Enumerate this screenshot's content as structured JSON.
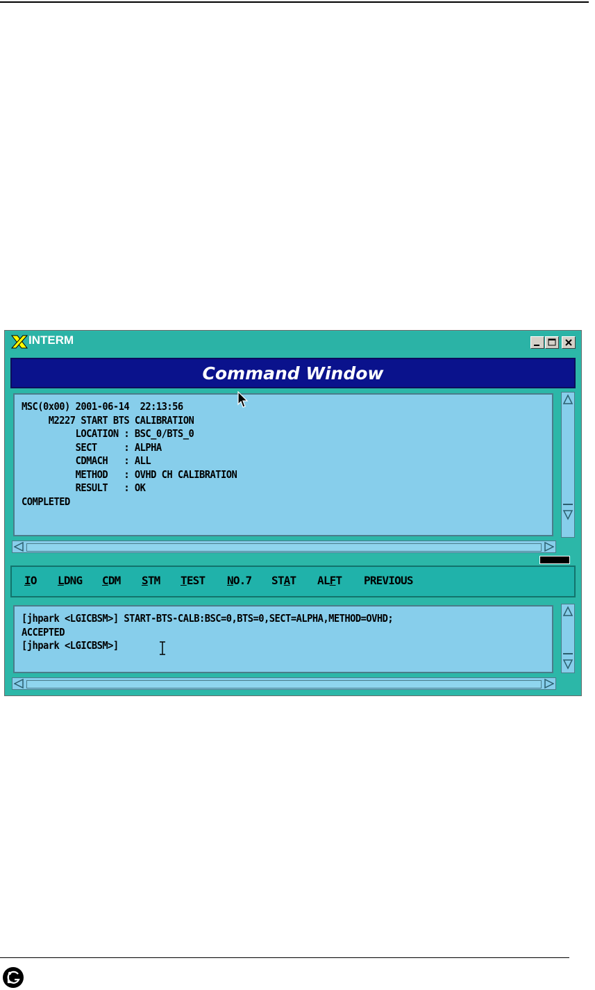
{
  "window": {
    "title": "INTERM"
  },
  "banner": {
    "title": "Command Window"
  },
  "output": {
    "lines": [
      "MSC(0x00) 2001-06-14  22:13:56",
      "     M2227 START BTS CALIBRATION",
      "          LOCATION : BSC_0/BTS_0",
      "          SECT     : ALPHA",
      "          CDMACH   : ALL",
      "          METHOD   : OVHD CH CALIBRATION",
      "          RESULT   : OK",
      "COMPLETED"
    ]
  },
  "menu": {
    "items": [
      {
        "pre": "",
        "u": "I",
        "post": "O"
      },
      {
        "pre": "",
        "u": "L",
        "post": "DNG"
      },
      {
        "pre": "",
        "u": "C",
        "post": "DM"
      },
      {
        "pre": "",
        "u": "S",
        "post": "TM"
      },
      {
        "pre": "",
        "u": "T",
        "post": "EST"
      },
      {
        "pre": "",
        "u": "N",
        "post": "O.7"
      },
      {
        "pre": "ST",
        "u": "A",
        "post": "T"
      },
      {
        "pre": "AL",
        "u": "F",
        "post": "T"
      },
      {
        "pre": "PREVIOUS",
        "u": "",
        "post": ""
      }
    ]
  },
  "input": {
    "lines": [
      "[jhpark <LGICBSM>] START-BTS-CALB:BSC=0,BTS=0,SECT=ALPHA,METHOD=OVHD;",
      "ACCEPTED",
      "[jhpark <LGICBSM>]"
    ]
  },
  "colors": {
    "window_bg": "#2cb7a8",
    "banner_bg": "#0a128c",
    "pane_bg": "#87ceeb",
    "menu_bg": "#20b2aa"
  }
}
